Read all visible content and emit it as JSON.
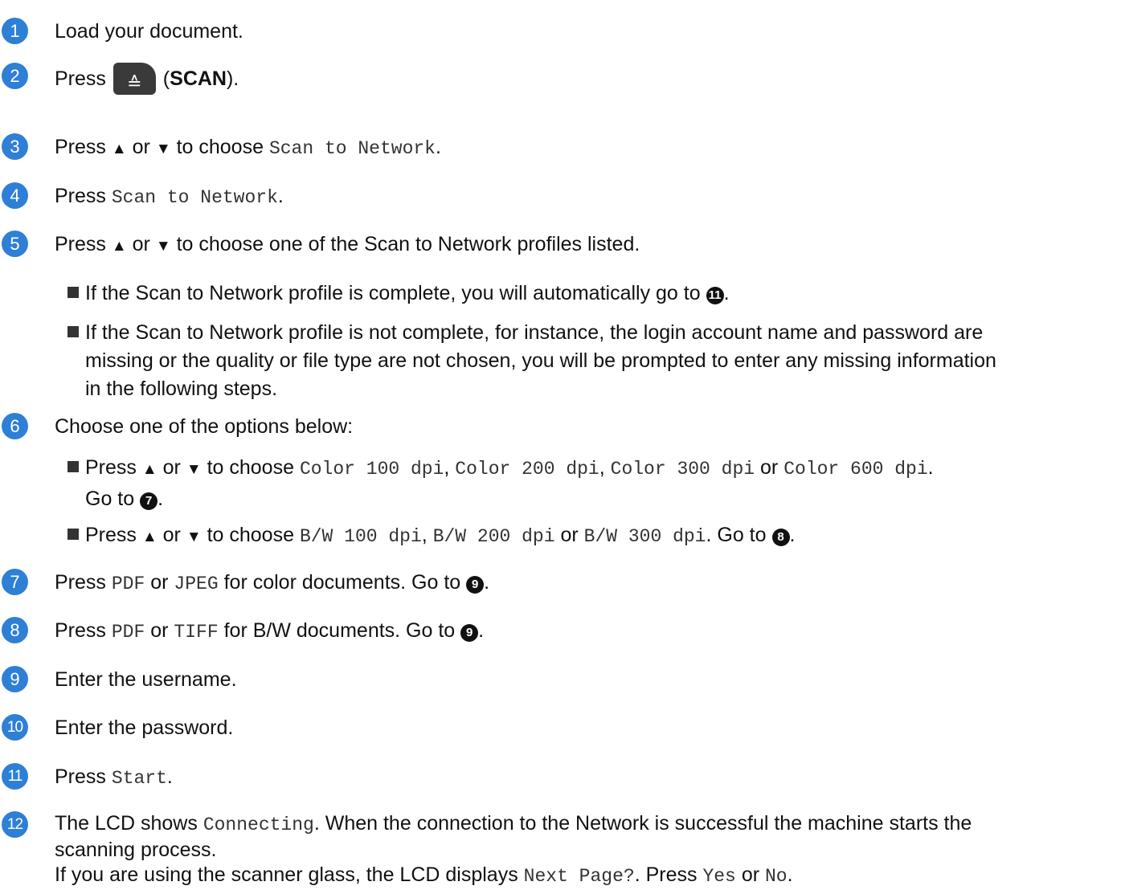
{
  "steps": [
    {
      "num": "1",
      "text": "Load your document."
    },
    {
      "num": "2",
      "pre": "Press",
      "button_name": "SCAN",
      "post": ")."
    },
    {
      "num": "3",
      "pre": "Press",
      "arrow_up": "▲",
      "or": "or",
      "arrow_down": "▼",
      "mid": "to choose",
      "code": "Scan to Network",
      "post": "."
    },
    {
      "num": "4",
      "pre": "Press",
      "code": "Scan to Network",
      "post": "."
    },
    {
      "num": "5",
      "pre": "Press",
      "arrow_up": "▲",
      "or": "or",
      "arrow_down": "▼",
      "post": "to choose one of the Scan to Network profiles listed.",
      "bullets": [
        {
          "text": "If the Scan to Network profile is complete, you will automatically go to",
          "ref": "11",
          "post": "."
        },
        {
          "line1": "If the Scan to Network profile is not complete, for instance, the login account name and password are",
          "line2": "missing or the quality or file type are not chosen, you will be prompted to enter any missing information",
          "line3": "in the following steps."
        }
      ]
    },
    {
      "num": "6",
      "text": "Choose one of the options below:",
      "bullets": [
        {
          "pre": "Press",
          "arrow_up": "▲",
          "or": "or",
          "arrow_down": "▼",
          "mid": "to choose",
          "code1": "Color 100 dpi",
          "sep1": ",",
          "code2": "Color 200 dpi",
          "sep2": ",",
          "code3": "Color 300 dpi",
          "or2": "or",
          "code4": "Color 600 dpi",
          "end": ".",
          "goto": "Go to",
          "ref": "7",
          "post": "."
        },
        {
          "pre": "Press",
          "arrow_up": "▲",
          "or": "or",
          "arrow_down": "▼",
          "mid": "to choose",
          "code1": "B/W 100 dpi",
          "sep1": ",",
          "code2": "B/W 200 dpi",
          "or2": "or",
          "code3": "B/W 300 dpi",
          "end": ".",
          "goto": "Go to",
          "ref": "8",
          "post": "."
        }
      ]
    },
    {
      "num": "7",
      "pre": "Press",
      "code1": "PDF",
      "or": "or",
      "code2": "JPEG",
      "mid": "for color documents. Go to",
      "ref": "9",
      "post": "."
    },
    {
      "num": "8",
      "pre": "Press",
      "code1": "PDF",
      "or": "or",
      "code2": "TIFF",
      "mid": "for B/W documents. Go to",
      "ref": "9",
      "post": "."
    },
    {
      "num": "9",
      "text": "Enter the username."
    },
    {
      "num": "10",
      "text": "Enter the password."
    },
    {
      "num": "11",
      "pre": "Press",
      "code": "Start",
      "post": "."
    },
    {
      "num": "12",
      "pre": "The LCD shows",
      "code": "Connecting",
      "post": ". When the connection to the Network is successful the machine starts the",
      "line2": "scanning process.",
      "line3_pre": "If you are using the scanner glass, the LCD displays",
      "line3_code1": "Next Page?",
      "line3_mid": ". Press",
      "line3_code2": "Yes",
      "line3_or": "or",
      "line3_code3": "No",
      "line3_end": "."
    }
  ],
  "icons": {
    "scan_button": "scan-key-icon",
    "scan_glyph": "≙"
  },
  "colors": {
    "step_badge": "#2e7fd6",
    "ref_badge": "#111111",
    "scan_key": "#3a3a3a"
  }
}
